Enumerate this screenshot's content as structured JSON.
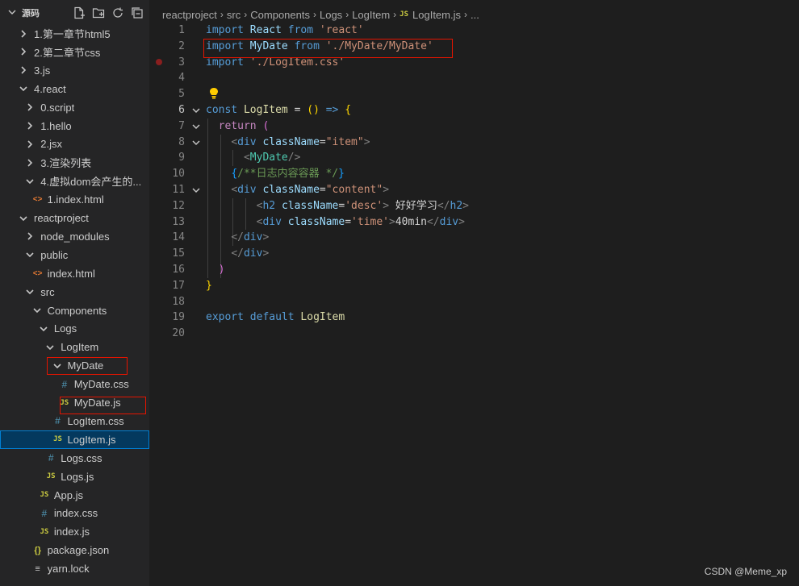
{
  "explorer": {
    "title": "源码",
    "actions": [
      "new-file-icon",
      "new-folder-icon",
      "refresh-icon",
      "collapse-all-icon"
    ],
    "items": [
      {
        "label": "1.第一章节html5",
        "kind": "folder",
        "open": false,
        "depth": 1
      },
      {
        "label": "2.第二章节css",
        "kind": "folder",
        "open": false,
        "depth": 1
      },
      {
        "label": "3.js",
        "kind": "folder",
        "open": false,
        "depth": 1
      },
      {
        "label": "4.react",
        "kind": "folder",
        "open": true,
        "depth": 1
      },
      {
        "label": "0.script",
        "kind": "folder",
        "open": false,
        "depth": 2
      },
      {
        "label": "1.hello",
        "kind": "folder",
        "open": false,
        "depth": 2
      },
      {
        "label": "2.jsx",
        "kind": "folder",
        "open": false,
        "depth": 2
      },
      {
        "label": "3.渲染列表",
        "kind": "folder",
        "open": false,
        "depth": 2
      },
      {
        "label": "4.虚拟dom会产生的...",
        "kind": "folder",
        "open": true,
        "depth": 2
      },
      {
        "label": "1.index.html",
        "kind": "html",
        "depth": 3
      },
      {
        "label": "reactproject",
        "kind": "folder",
        "open": true,
        "depth": 1
      },
      {
        "label": "node_modules",
        "kind": "folder",
        "open": false,
        "depth": 2
      },
      {
        "label": "public",
        "kind": "folder",
        "open": true,
        "depth": 2
      },
      {
        "label": "index.html",
        "kind": "html",
        "depth": 3
      },
      {
        "label": "src",
        "kind": "folder",
        "open": true,
        "depth": 2
      },
      {
        "label": "Components",
        "kind": "folder",
        "open": true,
        "depth": 3
      },
      {
        "label": "Logs",
        "kind": "folder",
        "open": true,
        "depth": 4
      },
      {
        "label": "LogItem",
        "kind": "folder",
        "open": true,
        "depth": 5
      },
      {
        "label": "MyDate",
        "kind": "folder",
        "open": true,
        "depth": 6
      },
      {
        "label": "MyDate.css",
        "kind": "css",
        "depth": 7
      },
      {
        "label": "MyDate.js",
        "kind": "js",
        "depth": 7
      },
      {
        "label": "LogItem.css",
        "kind": "css",
        "depth": 6
      },
      {
        "label": "LogItem.js",
        "kind": "js",
        "depth": 6,
        "selected": true
      },
      {
        "label": "Logs.css",
        "kind": "css",
        "depth": 5
      },
      {
        "label": "Logs.js",
        "kind": "js",
        "depth": 5
      },
      {
        "label": "App.js",
        "kind": "js",
        "depth": 4
      },
      {
        "label": "index.css",
        "kind": "css",
        "depth": 4
      },
      {
        "label": "index.js",
        "kind": "js",
        "depth": 4
      },
      {
        "label": "package.json",
        "kind": "json",
        "depth": 3
      },
      {
        "label": "yarn.lock",
        "kind": "lock",
        "depth": 3
      }
    ]
  },
  "breadcrumb": [
    "reactproject",
    "src",
    "Components",
    "Logs",
    "LogItem",
    "LogItem.js",
    "..."
  ],
  "icons": {
    "js": "JS",
    "css": "#",
    "html": "<>",
    "json": "{}",
    "lock": "≡"
  },
  "editor": {
    "lines": [
      {
        "n": "1",
        "tokens": [
          [
            "kw",
            "import"
          ],
          [
            "txt",
            " "
          ],
          [
            "var",
            "React"
          ],
          [
            "txt",
            " "
          ],
          [
            "kw",
            "from"
          ],
          [
            "txt",
            " "
          ],
          [
            "str",
            "'react'"
          ]
        ]
      },
      {
        "n": "2",
        "tokens": [
          [
            "kw",
            "import"
          ],
          [
            "txt",
            " "
          ],
          [
            "var",
            "MyDate"
          ],
          [
            "txt",
            " "
          ],
          [
            "kw",
            "from"
          ],
          [
            "txt",
            " "
          ],
          [
            "str",
            "'./MyDate/MyDate'"
          ]
        ]
      },
      {
        "n": "3",
        "tokens": [
          [
            "kw",
            "import"
          ],
          [
            "txt",
            " "
          ],
          [
            "str",
            "'./LogItem.css'"
          ]
        ]
      },
      {
        "n": "4",
        "tokens": []
      },
      {
        "n": "5",
        "tokens": []
      },
      {
        "n": "6",
        "tokens": [
          [
            "kw",
            "const"
          ],
          [
            "txt",
            " "
          ],
          [
            "fn",
            "LogItem"
          ],
          [
            "txt",
            " = "
          ],
          [
            "br1",
            "()"
          ],
          [
            "txt",
            " "
          ],
          [
            "kw",
            "=>"
          ],
          [
            "txt",
            " "
          ],
          [
            "br1",
            "{"
          ]
        ]
      },
      {
        "n": "7",
        "tokens": [
          [
            "txt",
            "  "
          ],
          [
            "ctrl",
            "return"
          ],
          [
            "txt",
            " "
          ],
          [
            "br2",
            "("
          ]
        ]
      },
      {
        "n": "8",
        "tokens": [
          [
            "txt",
            "    "
          ],
          [
            "punc",
            "<"
          ],
          [
            "tag",
            "div"
          ],
          [
            "txt",
            " "
          ],
          [
            "var",
            "className"
          ],
          [
            "txt",
            "="
          ],
          [
            "str",
            "\"item\""
          ],
          [
            "punc",
            ">"
          ]
        ]
      },
      {
        "n": "9",
        "tokens": [
          [
            "txt",
            "      "
          ],
          [
            "punc",
            "<"
          ],
          [
            "comp",
            "MyDate"
          ],
          [
            "punc",
            "/>"
          ]
        ]
      },
      {
        "n": "10",
        "tokens": [
          [
            "txt",
            "    "
          ],
          [
            "br3",
            "{"
          ],
          [
            "cmt",
            "/**日志内容容器 */"
          ],
          [
            "br3",
            "}"
          ]
        ]
      },
      {
        "n": "11",
        "tokens": [
          [
            "txt",
            "    "
          ],
          [
            "punc",
            "<"
          ],
          [
            "tag",
            "div"
          ],
          [
            "txt",
            " "
          ],
          [
            "var",
            "className"
          ],
          [
            "txt",
            "="
          ],
          [
            "str",
            "\"content\""
          ],
          [
            "punc",
            ">"
          ]
        ]
      },
      {
        "n": "12",
        "tokens": [
          [
            "txt",
            "        "
          ],
          [
            "punc",
            "<"
          ],
          [
            "tag",
            "h2"
          ],
          [
            "txt",
            " "
          ],
          [
            "var",
            "className"
          ],
          [
            "txt",
            "="
          ],
          [
            "str",
            "'desc'"
          ],
          [
            "punc",
            ">"
          ],
          [
            "txt",
            " 好好学习"
          ],
          [
            "punc",
            "</"
          ],
          [
            "tag",
            "h2"
          ],
          [
            "punc",
            ">"
          ]
        ]
      },
      {
        "n": "13",
        "tokens": [
          [
            "txt",
            "        "
          ],
          [
            "punc",
            "<"
          ],
          [
            "tag",
            "div"
          ],
          [
            "txt",
            " "
          ],
          [
            "var",
            "className"
          ],
          [
            "txt",
            "="
          ],
          [
            "str",
            "'time'"
          ],
          [
            "punc",
            ">"
          ],
          [
            "txt",
            "40min"
          ],
          [
            "punc",
            "</"
          ],
          [
            "tag",
            "div"
          ],
          [
            "punc",
            ">"
          ]
        ]
      },
      {
        "n": "14",
        "tokens": [
          [
            "txt",
            "    "
          ],
          [
            "punc",
            "</"
          ],
          [
            "tag",
            "div"
          ],
          [
            "punc",
            ">"
          ]
        ]
      },
      {
        "n": "15",
        "tokens": [
          [
            "txt",
            "    "
          ],
          [
            "punc",
            "</"
          ],
          [
            "tag",
            "div"
          ],
          [
            "punc",
            ">"
          ]
        ]
      },
      {
        "n": "16",
        "tokens": [
          [
            "txt",
            "  "
          ],
          [
            "br2",
            ")"
          ]
        ]
      },
      {
        "n": "17",
        "tokens": [
          [
            "br1",
            "}"
          ]
        ]
      },
      {
        "n": "18",
        "tokens": []
      },
      {
        "n": "19",
        "tokens": [
          [
            "kw",
            "export"
          ],
          [
            "txt",
            " "
          ],
          [
            "kw",
            "default"
          ],
          [
            "txt",
            " "
          ],
          [
            "fn",
            "LogItem"
          ]
        ]
      },
      {
        "n": "20",
        "tokens": []
      }
    ],
    "active_line": "6",
    "fold_lines": [
      "6",
      "7",
      "8",
      "11"
    ]
  },
  "watermark": "CSDN @Meme_xp"
}
